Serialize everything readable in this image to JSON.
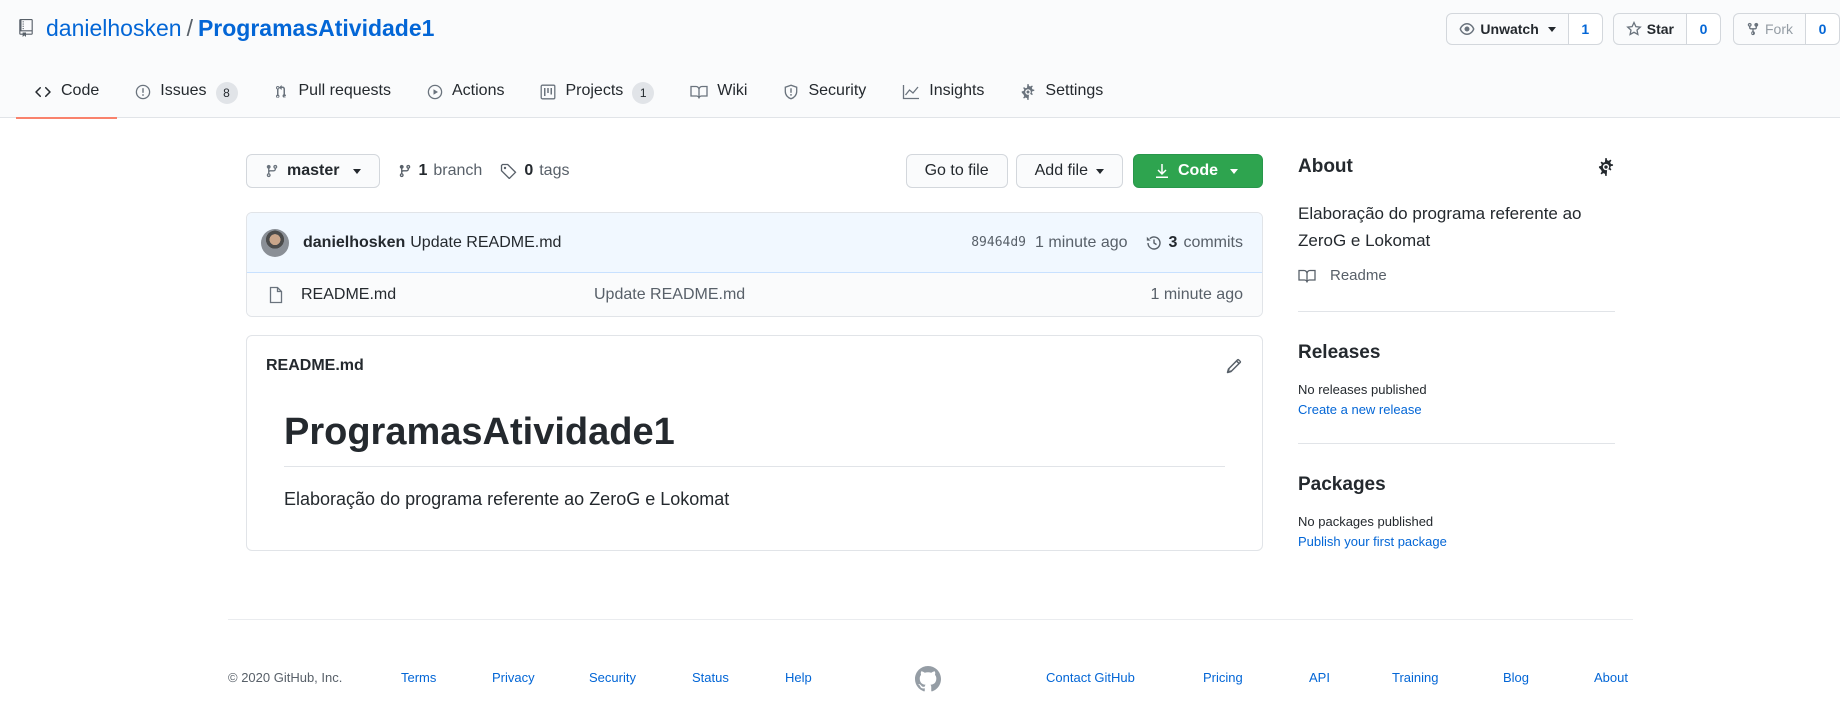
{
  "repo": {
    "owner": "danielhosken",
    "separator": "/",
    "name": "ProgramasAtividade1"
  },
  "actions": {
    "watch_label": "Unwatch",
    "watch_count": "1",
    "star_label": "Star",
    "star_count": "0",
    "fork_label": "Fork",
    "fork_count": "0"
  },
  "tabs": [
    {
      "label": "Code",
      "icon": "code-icon",
      "selected": true
    },
    {
      "label": "Issues",
      "icon": "issue-icon",
      "counter": "8"
    },
    {
      "label": "Pull requests",
      "icon": "pull-request-icon"
    },
    {
      "label": "Actions",
      "icon": "play-icon"
    },
    {
      "label": "Projects",
      "icon": "project-icon",
      "counter": "1"
    },
    {
      "label": "Wiki",
      "icon": "book-icon"
    },
    {
      "label": "Security",
      "icon": "shield-icon"
    },
    {
      "label": "Insights",
      "icon": "graph-icon"
    },
    {
      "label": "Settings",
      "icon": "gear-icon"
    }
  ],
  "file_nav": {
    "branch_name": "master",
    "branch_count": "1",
    "branch_label": "branch",
    "tag_count": "0",
    "tag_label": "tags",
    "go_to_file": "Go to file",
    "add_file": "Add file",
    "code_button": "Code"
  },
  "latest_commit": {
    "author": "danielhosken",
    "message": "Update README.md",
    "sha": "89464d9",
    "age": "1 minute ago",
    "commit_count": "3",
    "commit_label": "commits"
  },
  "files": [
    {
      "name": "README.md",
      "message": "Update README.md",
      "age": "1 minute ago",
      "icon": "file-icon"
    }
  ],
  "readme": {
    "filename": "README.md",
    "heading": "ProgramasAtividade1",
    "body": "Elaboração do programa referente ao ZeroG e Lokomat"
  },
  "sidebar": {
    "about_title": "About",
    "about_text": "Elaboração do programa referente ao ZeroG e Lokomat",
    "readme_link": "Readme",
    "releases_title": "Releases",
    "releases_empty": "No releases published",
    "releases_link": "Create a new release",
    "packages_title": "Packages",
    "packages_empty": "No packages published",
    "packages_link": "Publish your first package"
  },
  "footer": {
    "copyright": "© 2020 GitHub, Inc.",
    "left_links": [
      "Terms",
      "Privacy",
      "Security",
      "Status",
      "Help"
    ],
    "right_links": [
      "Contact GitHub",
      "Pricing",
      "API",
      "Training",
      "Blog",
      "About"
    ]
  },
  "colors": {
    "link": "#0366d6",
    "primary_button": "#2ea44f",
    "selected_tab_underline": "#f9826c"
  }
}
